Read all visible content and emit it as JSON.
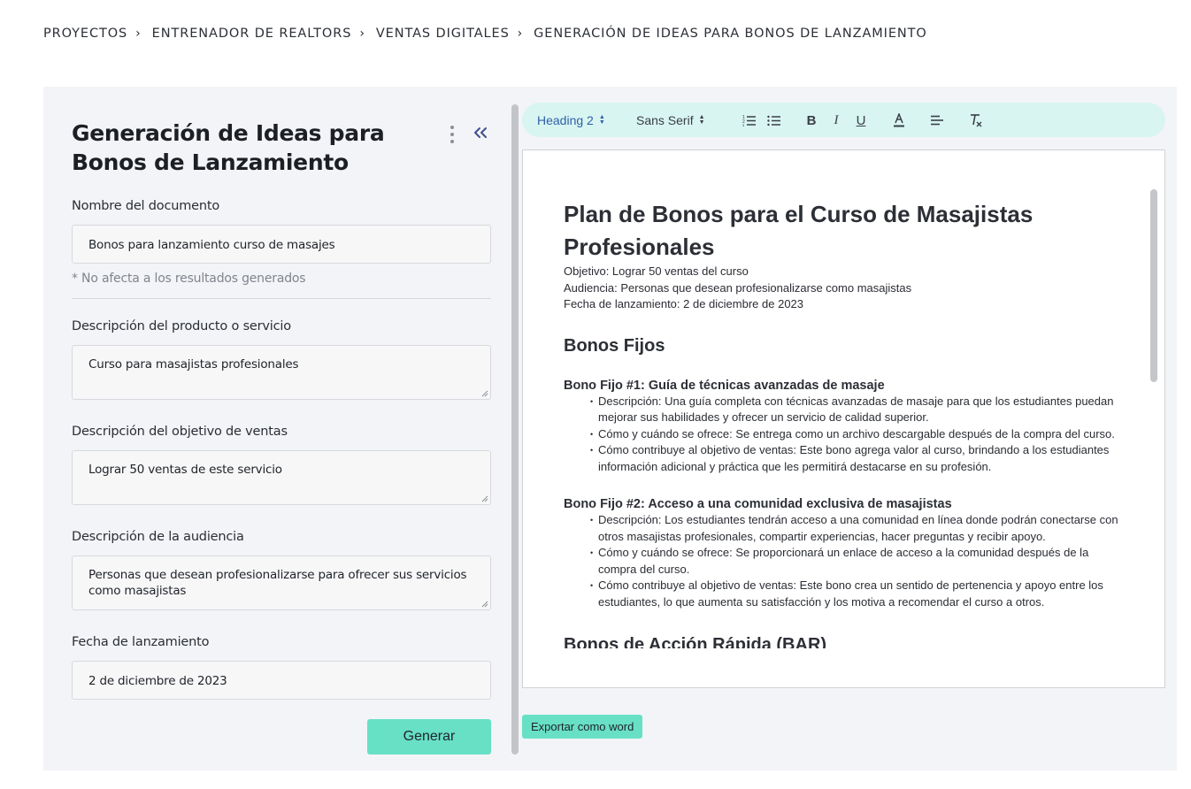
{
  "breadcrumb": [
    "PROYECTOS",
    "ENTRENADOR DE REALTORS",
    "VENTAS DIGITALES",
    "GENERACIÓN DE IDEAS PARA BONOS DE LANZAMIENTO"
  ],
  "form": {
    "title": "Generación de Ideas para Bonos de Lanzamiento",
    "doc_name_label": "Nombre del documento",
    "doc_name_value": "Bonos para lanzamiento curso de masajes",
    "doc_name_hint": "* No afecta a los resultados generados",
    "product_label": "Descripción del producto o servicio",
    "product_value": "Curso para masajistas profesionales",
    "goal_label": "Descripción del objetivo de ventas",
    "goal_value": "Lograr 50 ventas de este servicio",
    "audience_label": "Descripción de la audiencia",
    "audience_value": "Personas que desean profesionalizarse para ofrecer sus servicios como masajistas",
    "date_label": "Fecha de lanzamiento",
    "date_value": "2 de diciembre de 2023",
    "generate_label": "Generar"
  },
  "toolbar": {
    "heading_select": "Heading 2",
    "font_select": "Sans Serif",
    "icons": [
      "ordered-list-icon",
      "bullet-list-icon",
      "bold-icon",
      "italic-icon",
      "underline-icon",
      "text-color-icon",
      "align-icon",
      "clear-format-icon"
    ]
  },
  "document": {
    "title": "Plan de Bonos para el Curso de Masajistas Profesionales",
    "meta": [
      "Objetivo: Lograr 50 ventas del curso",
      "Audiencia: Personas que desean profesionalizarse como masajistas",
      "Fecha de lanzamiento: 2 de diciembre de 2023"
    ],
    "section_title": "Bonos Fijos",
    "bonus1_title": "Bono Fijo #1: Guía de técnicas avanzadas de masaje",
    "bonus1_items": [
      "Descripción: Una guía completa con técnicas avanzadas de masaje para que los estudiantes puedan mejorar sus habilidades y ofrecer un servicio de calidad superior.",
      "Cómo y cuándo se ofrece: Se entrega como un archivo descargable después de la compra del curso.",
      "Cómo contribuye al objetivo de ventas: Este bono agrega valor al curso, brindando a los estudiantes información adicional y práctica que les permitirá destacarse en su profesión."
    ],
    "bonus2_title": "Bono Fijo #2: Acceso a una comunidad exclusiva de masajistas",
    "bonus2_items": [
      "Descripción: Los estudiantes tendrán acceso a una comunidad en línea donde podrán conectarse con otros masajistas profesionales, compartir experiencias, hacer preguntas y recibir apoyo.",
      "Cómo y cuándo se ofrece: Se proporcionará un enlace de acceso a la comunidad después de la compra del curso.",
      "Cómo contribuye al objetivo de ventas: Este bono crea un sentido de pertenencia y apoyo entre los estudiantes, lo que aumenta su satisfacción y los motiva a recomendar el curso a otros."
    ],
    "next_section_title": "Bonos de Acción Rápida (BAR)"
  },
  "export_label": "Exportar como word",
  "colors": {
    "accent": "#67e0c6",
    "toolbar_bg": "#d8f5f1",
    "panel_bg": "#f3f4f7",
    "link_blue": "#2f5fa7"
  }
}
